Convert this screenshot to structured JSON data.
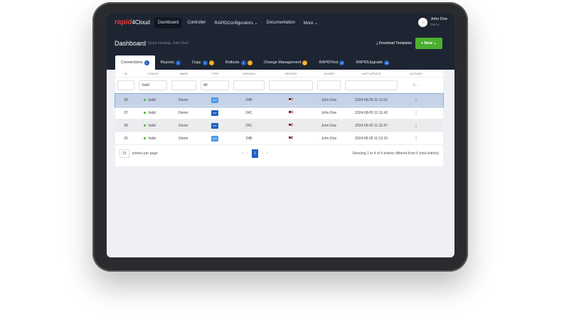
{
  "app": {
    "logo": "rapid",
    "logo_suffix": "4Cloud"
  },
  "nav": [
    {
      "label": "Dashboard",
      "icon": "home-icon"
    },
    {
      "label": "Controller",
      "icon": "monitor-icon"
    },
    {
      "label": "RAPIDConfigurators ⌄",
      "icon": "server-icon"
    },
    {
      "label": "Documentation",
      "icon": "book-icon"
    },
    {
      "label": "More ⌄",
      "icon": "grid-icon"
    }
  ],
  "user": {
    "initials": "JD",
    "name": "John Doe",
    "org": "Demo"
  },
  "header": {
    "title": "Dashboard",
    "greeting": "Good morning, John Doe!",
    "download": "⤓ Download Templates",
    "new": "+ New ⌄"
  },
  "tabs": [
    {
      "label": "Connections",
      "badges": [
        "2"
      ]
    },
    {
      "label": "Reports",
      "badges": [
        "1"
      ]
    },
    {
      "label": "Copy",
      "badges": [
        "3",
        "1"
      ]
    },
    {
      "label": "Rollouts",
      "badges": [
        "1",
        "1"
      ]
    },
    {
      "label": "Change Management",
      "badges": [
        "1"
      ]
    },
    {
      "label": "RAPIDTest",
      "badges": [
        "47"
      ]
    },
    {
      "label": "RAPIDUpgrade",
      "badges": [
        "49"
      ]
    }
  ],
  "columns": [
    "ID",
    "STATUS",
    "NAME",
    "TYPE",
    "VERSION",
    "REGION",
    "OWNER",
    "LAST UPDATE",
    "ACTIONS"
  ],
  "filters": {
    "status": "Valid",
    "type": "All"
  },
  "rows": [
    {
      "id": "38",
      "status": "Valid",
      "name": "Demo",
      "type": "APP",
      "version": "24B",
      "owner": "John Doe",
      "updated": "2024-09-05 11:11:53"
    },
    {
      "id": "37",
      "status": "Valid",
      "name": "Demo",
      "type": "DIP",
      "version": "24C",
      "owner": "John Doe",
      "updated": "2024-09-05 11:11:43"
    },
    {
      "id": "28",
      "status": "Valid",
      "name": "Demo",
      "type": "DIP",
      "version": "24C",
      "owner": "John Doe",
      "updated": "2024-09-05 11:11:47"
    },
    {
      "id": "26",
      "status": "Valid",
      "name": "Demo",
      "type": "APP",
      "version": "24B",
      "owner": "John Doe",
      "updated": "2024-09-05 11:12:16"
    }
  ],
  "footer": {
    "per_page": "15",
    "per_page_label": "entries per page",
    "page": "1",
    "summary": "Showing 1 to 4 of 4 entries (filtered from 6 total entries)"
  },
  "colors": {
    "app": "#4a9be8",
    "dip": "#1f5fc2",
    "accent": "#4caf32"
  }
}
